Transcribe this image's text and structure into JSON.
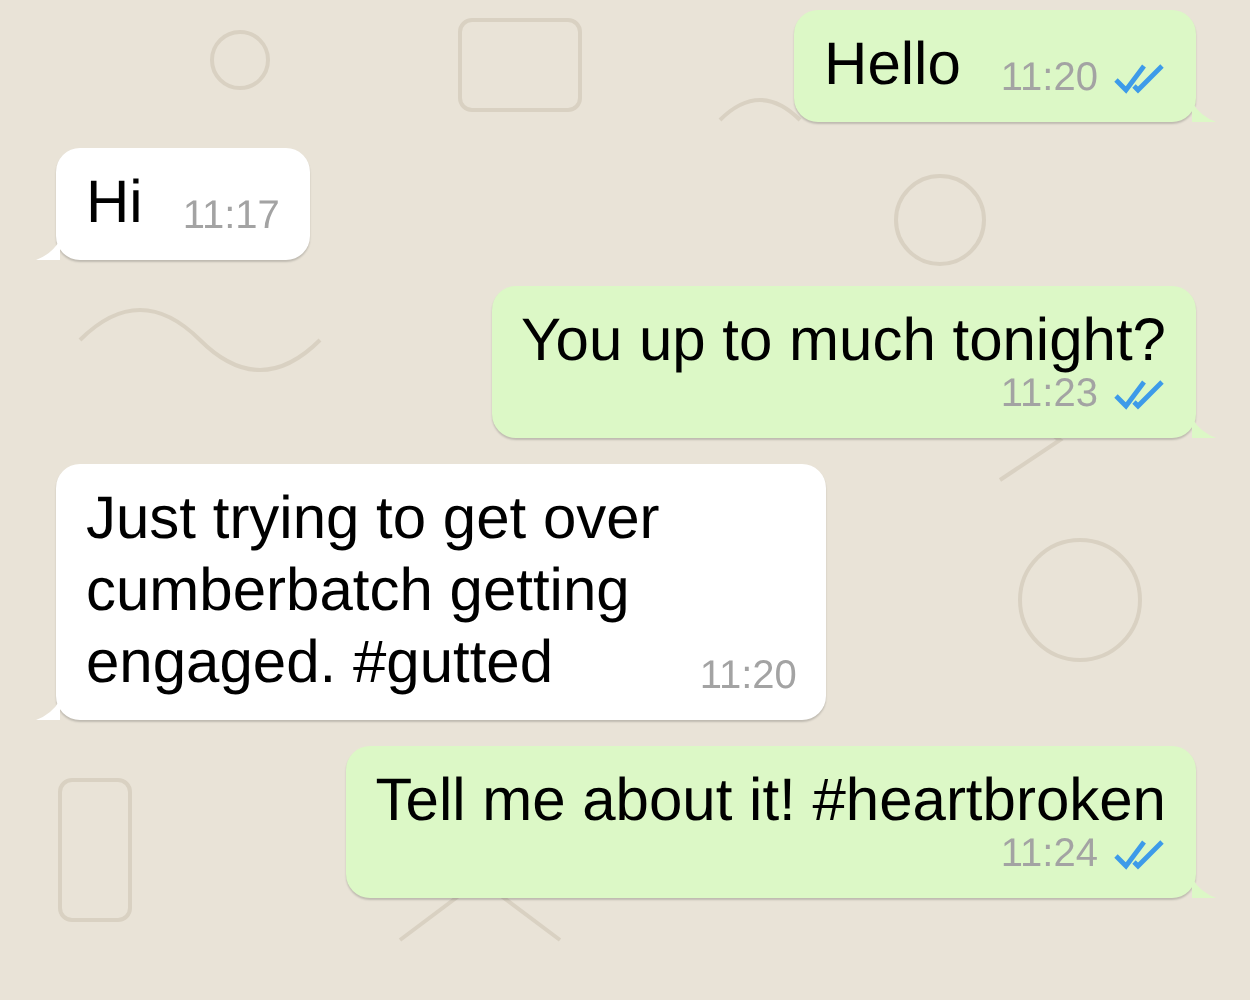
{
  "messages": [
    {
      "kind": "outgoing",
      "text": "Hello",
      "time": "11:20",
      "read": true
    },
    {
      "kind": "incoming",
      "text": "Hi",
      "time": "11:17"
    },
    {
      "kind": "outgoing",
      "text": "You up to much tonight?",
      "time": "11:23",
      "read": true
    },
    {
      "kind": "incoming",
      "text": "Just trying to get over\ncumberbatch getting\nengaged. #gutted",
      "time": "11:20"
    },
    {
      "kind": "outgoing",
      "text": "Tell me about it! #heartbroken",
      "time": "11:24",
      "read": true
    }
  ]
}
